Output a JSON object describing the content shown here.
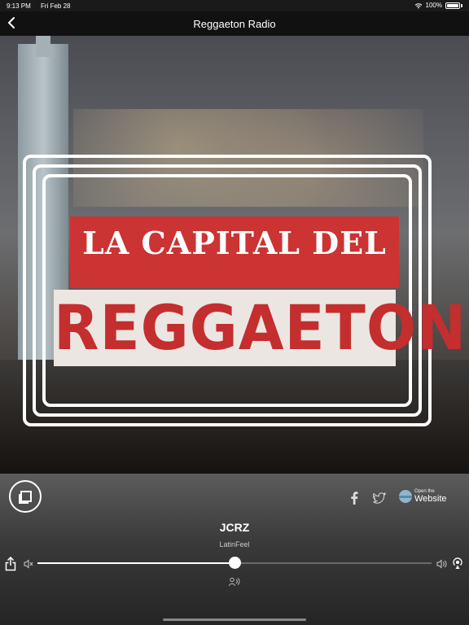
{
  "status_bar": {
    "time": "9:13 PM",
    "date": "Fri Feb 28",
    "battery": "100%"
  },
  "nav": {
    "title": "Reggaeton Radio",
    "back_icon": "chevron-left-icon"
  },
  "artwork": {
    "line1": "LA CAPITAL DEL",
    "line2": "REGGAETON",
    "accent_color": "#cc3333"
  },
  "player": {
    "song_title": "JCRZ",
    "artist": "LatinFeel",
    "volume_fraction": 0.5,
    "website": {
      "small": "Open the",
      "big": "Website"
    },
    "icons": {
      "stop": "stop-icon",
      "facebook": "facebook-icon",
      "twitter": "twitter-icon",
      "globe": "globe-icon",
      "share": "share-icon",
      "volume_min": "volume-min-icon",
      "volume_max": "volume-max-icon",
      "airplay": "airplay-icon",
      "speak": "speak-icon"
    }
  }
}
